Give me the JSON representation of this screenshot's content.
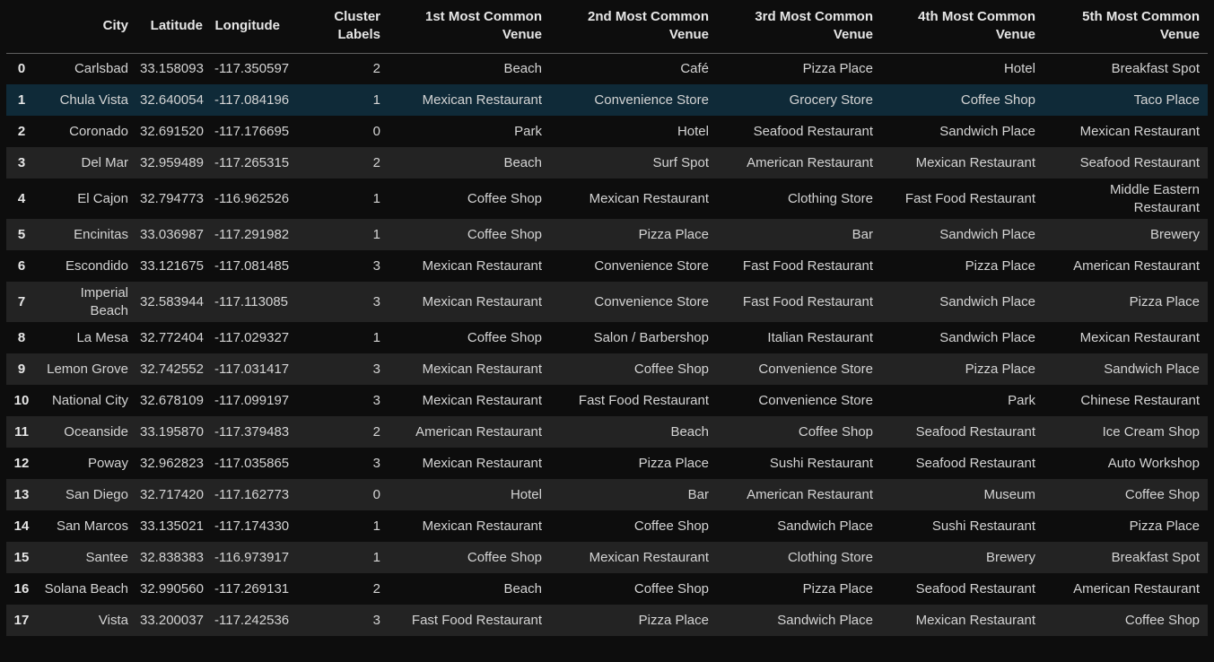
{
  "table": {
    "columns": [
      "",
      "City",
      "Latitude",
      "Longitude",
      "Cluster Labels",
      "1st Most Common Venue",
      "2nd Most Common Venue",
      "3rd Most Common Venue",
      "4th Most Common Venue",
      "5th Most Common Venue"
    ],
    "highlighted_row": 1,
    "rows": [
      [
        "0",
        "Carlsbad",
        "33.158093",
        "-117.350597",
        "2",
        "Beach",
        "Café",
        "Pizza Place",
        "Hotel",
        "Breakfast Spot"
      ],
      [
        "1",
        "Chula Vista",
        "32.640054",
        "-117.084196",
        "1",
        "Mexican Restaurant",
        "Convenience Store",
        "Grocery Store",
        "Coffee Shop",
        "Taco Place"
      ],
      [
        "2",
        "Coronado",
        "32.691520",
        "-117.176695",
        "0",
        "Park",
        "Hotel",
        "Seafood Restaurant",
        "Sandwich Place",
        "Mexican Restaurant"
      ],
      [
        "3",
        "Del Mar",
        "32.959489",
        "-117.265315",
        "2",
        "Beach",
        "Surf Spot",
        "American Restaurant",
        "Mexican Restaurant",
        "Seafood Restaurant"
      ],
      [
        "4",
        "El Cajon",
        "32.794773",
        "-116.962526",
        "1",
        "Coffee Shop",
        "Mexican Restaurant",
        "Clothing Store",
        "Fast Food Restaurant",
        "Middle Eastern Restaurant"
      ],
      [
        "5",
        "Encinitas",
        "33.036987",
        "-117.291982",
        "1",
        "Coffee Shop",
        "Pizza Place",
        "Bar",
        "Sandwich Place",
        "Brewery"
      ],
      [
        "6",
        "Escondido",
        "33.121675",
        "-117.081485",
        "3",
        "Mexican Restaurant",
        "Convenience Store",
        "Fast Food Restaurant",
        "Pizza Place",
        "American Restaurant"
      ],
      [
        "7",
        "Imperial Beach",
        "32.583944",
        "-117.113085",
        "3",
        "Mexican Restaurant",
        "Convenience Store",
        "Fast Food Restaurant",
        "Sandwich Place",
        "Pizza Place"
      ],
      [
        "8",
        "La Mesa",
        "32.772404",
        "-117.029327",
        "1",
        "Coffee Shop",
        "Salon / Barbershop",
        "Italian Restaurant",
        "Sandwich Place",
        "Mexican Restaurant"
      ],
      [
        "9",
        "Lemon Grove",
        "32.742552",
        "-117.031417",
        "3",
        "Mexican Restaurant",
        "Coffee Shop",
        "Convenience Store",
        "Pizza Place",
        "Sandwich Place"
      ],
      [
        "10",
        "National City",
        "32.678109",
        "-117.099197",
        "3",
        "Mexican Restaurant",
        "Fast Food Restaurant",
        "Convenience Store",
        "Park",
        "Chinese Restaurant"
      ],
      [
        "11",
        "Oceanside",
        "33.195870",
        "-117.379483",
        "2",
        "American Restaurant",
        "Beach",
        "Coffee Shop",
        "Seafood Restaurant",
        "Ice Cream Shop"
      ],
      [
        "12",
        "Poway",
        "32.962823",
        "-117.035865",
        "3",
        "Mexican Restaurant",
        "Pizza Place",
        "Sushi Restaurant",
        "Seafood Restaurant",
        "Auto Workshop"
      ],
      [
        "13",
        "San Diego",
        "32.717420",
        "-117.162773",
        "0",
        "Hotel",
        "Bar",
        "American Restaurant",
        "Museum",
        "Coffee Shop"
      ],
      [
        "14",
        "San Marcos",
        "33.135021",
        "-117.174330",
        "1",
        "Mexican Restaurant",
        "Coffee Shop",
        "Sandwich Place",
        "Sushi Restaurant",
        "Pizza Place"
      ],
      [
        "15",
        "Santee",
        "32.838383",
        "-116.973917",
        "1",
        "Coffee Shop",
        "Mexican Restaurant",
        "Clothing Store",
        "Brewery",
        "Breakfast Spot"
      ],
      [
        "16",
        "Solana Beach",
        "32.990560",
        "-117.269131",
        "2",
        "Beach",
        "Coffee Shop",
        "Pizza Place",
        "Seafood Restaurant",
        "American Restaurant"
      ],
      [
        "17",
        "Vista",
        "33.200037",
        "-117.242536",
        "3",
        "Fast Food Restaurant",
        "Pizza Place",
        "Sandwich Place",
        "Mexican Restaurant",
        "Coffee Shop"
      ]
    ]
  }
}
